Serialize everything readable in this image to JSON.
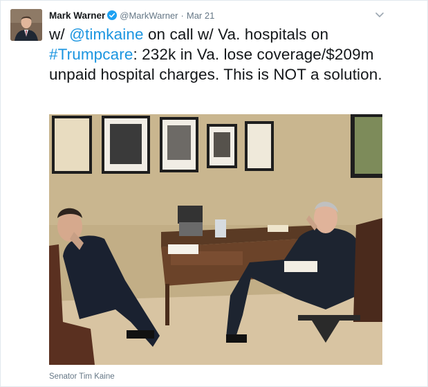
{
  "tweet": {
    "author_name": "Mark Warner",
    "handle": "@MarkWarner",
    "separator": "·",
    "timestamp": "Mar 21",
    "text_prefix": "w/ ",
    "mention": "@timkaine",
    "text_middle": " on call w/ Va. hospitals on ",
    "hashtag": "#Trumpcare",
    "text_suffix": ": 232k in Va. lose coverage/$209m unpaid hospital charges. This is NOT a solution.",
    "media_caption": "Senator Tim Kaine"
  },
  "colors": {
    "link": "#1b95e0",
    "verified_badge": "#1da1f2",
    "secondary_text": "#657786"
  },
  "icons": {
    "verified": "verified-badge-icon",
    "menu": "chevron-down-icon"
  }
}
